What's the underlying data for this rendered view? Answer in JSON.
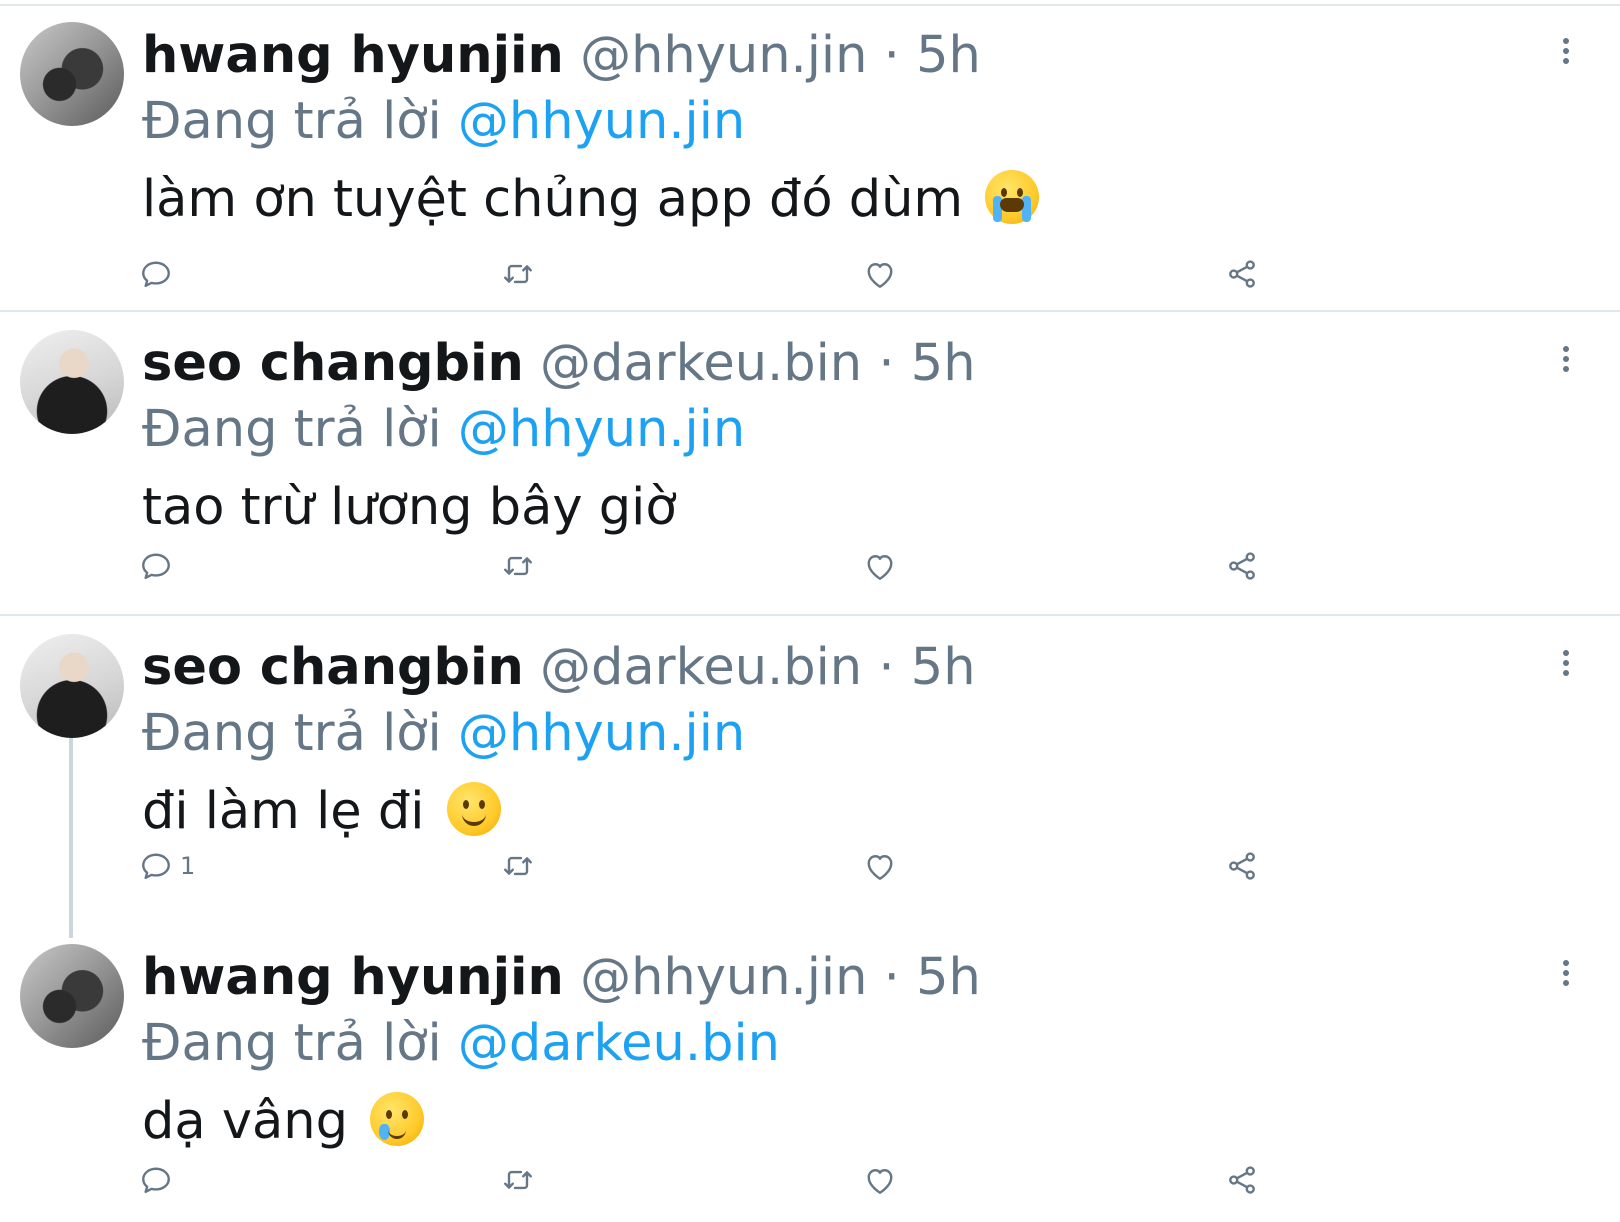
{
  "reply_prefix": "Đang trả lời",
  "tweets": [
    {
      "name": "hwang hyunjin",
      "handle": "@hhyun.jin",
      "time": "· 5h",
      "replying_to": "@hhyun.jin",
      "text": "làm ơn tuyệt chủng app đó dùm",
      "emoji": "loudly-crying-face",
      "reply_count": ""
    },
    {
      "name": "seo changbin",
      "handle": "@darkeu.bin",
      "time": "· 5h",
      "replying_to": "@hhyun.jin",
      "text": "tao trừ lương bây giờ",
      "emoji": "",
      "reply_count": ""
    },
    {
      "name": "seo changbin",
      "handle": "@darkeu.bin",
      "time": "· 5h",
      "replying_to": "@hhyun.jin",
      "text": "đi làm lẹ đi",
      "emoji": "slightly-smiling-face",
      "reply_count": "1"
    },
    {
      "name": "hwang hyunjin",
      "handle": "@hhyun.jin",
      "time": "· 5h",
      "replying_to": "@darkeu.bin",
      "text": "dạ vâng",
      "emoji": "face-holding-back-tears",
      "reply_count": ""
    }
  ],
  "colors": {
    "name": "#14171a",
    "secondary": "#657786",
    "mention": "#1da1f2",
    "divider": "#e1e8ed"
  }
}
